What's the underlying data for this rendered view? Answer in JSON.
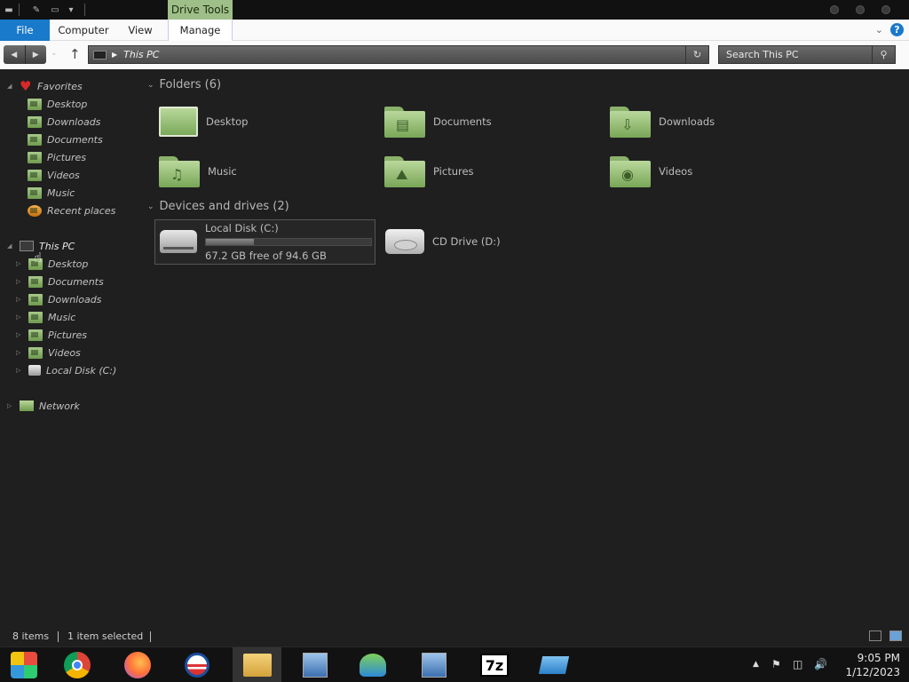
{
  "title_bar": {
    "contextual_tab": "Drive Tools"
  },
  "ribbon": {
    "tabs": [
      "File",
      "Computer",
      "View",
      "Manage"
    ]
  },
  "address_bar": {
    "path": "This PC"
  },
  "search": {
    "placeholder": "Search This PC"
  },
  "nav_pane": {
    "favorites_label": "Favorites",
    "favorites": [
      "Desktop",
      "Downloads",
      "Documents",
      "Pictures",
      "Videos",
      "Music",
      "Recent places"
    ],
    "this_pc_label": "This PC",
    "this_pc_items": [
      "Desktop",
      "Documents",
      "Downloads",
      "Music",
      "Pictures",
      "Videos",
      "Local Disk (C:)"
    ],
    "network_label": "Network"
  },
  "content": {
    "folders_header": "Folders (6)",
    "folders": [
      "Desktop",
      "Documents",
      "Downloads",
      "Music",
      "Pictures",
      "Videos"
    ],
    "devices_header": "Devices and drives (2)",
    "drives": [
      {
        "name": "Local Disk (C:)",
        "free_text": "67.2 GB free of 94.6 GB",
        "used_fraction": 0.29
      },
      {
        "name": "CD Drive (D:)"
      }
    ]
  },
  "status_bar": {
    "item_count": "8 items",
    "selection": "1 item selected"
  },
  "taskbar": {
    "apps": [
      "start-icon",
      "chrome-icon",
      "firefox-icon",
      "obama-campaign-icon",
      "file-explorer-icon",
      "network-setup-icon",
      "people-icon",
      "network-setup-icon-2",
      "7zip-icon",
      "virtual-drive-icon"
    ],
    "clock_time": "9:05 PM",
    "clock_date": "1/12/2023"
  },
  "colors": {
    "accent": "#1979ca",
    "context_tab": "#9fbf88",
    "folder_green": "#8bb26b",
    "background": "#1f1f1f"
  }
}
